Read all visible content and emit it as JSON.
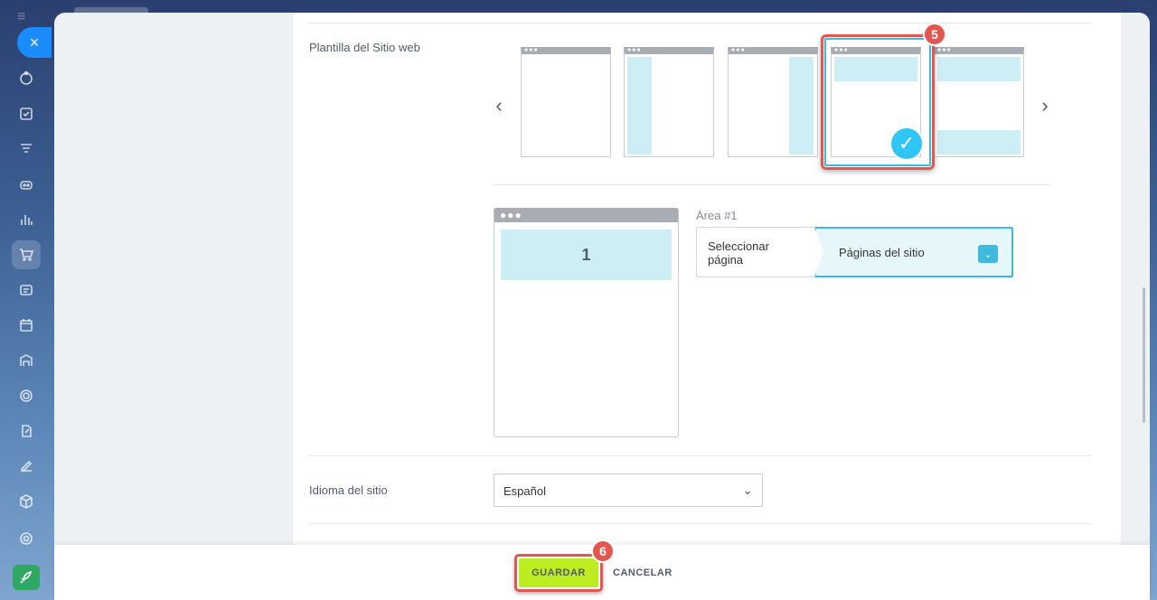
{
  "sidebar": {
    "close_label": "×",
    "menu_label": "≡",
    "icons": [
      "crm-icon",
      "tasks-icon",
      "filter-icon",
      "robot-icon",
      "analytics-icon",
      "cart-icon",
      "contact-center-icon",
      "calendar-icon",
      "inventory-icon",
      "target-icon",
      "document-edit-icon",
      "signature-icon",
      "box-icon",
      "settings-icon",
      "rocket-icon"
    ]
  },
  "form": {
    "template_label": "Plantilla del Sitio web",
    "language_label": "Idioma del sitio",
    "language_value": "Español",
    "area_title": "Área #1",
    "area_select_label": "Seleccionar página",
    "area_select_value": "Páginas del sitio",
    "preview_area_number": "1",
    "selected_template_index": 3,
    "templates": [
      "blank",
      "left-column",
      "right-column",
      "header-content",
      "header-footer"
    ]
  },
  "annotations": {
    "step5": "5",
    "step6": "6"
  },
  "footer": {
    "save_label": "GUARDAR",
    "cancel_label": "CANCELAR"
  },
  "colors": {
    "accent_blue": "#2fc6f6",
    "highlight_red": "#e3574f",
    "save_green": "#bbed21"
  }
}
